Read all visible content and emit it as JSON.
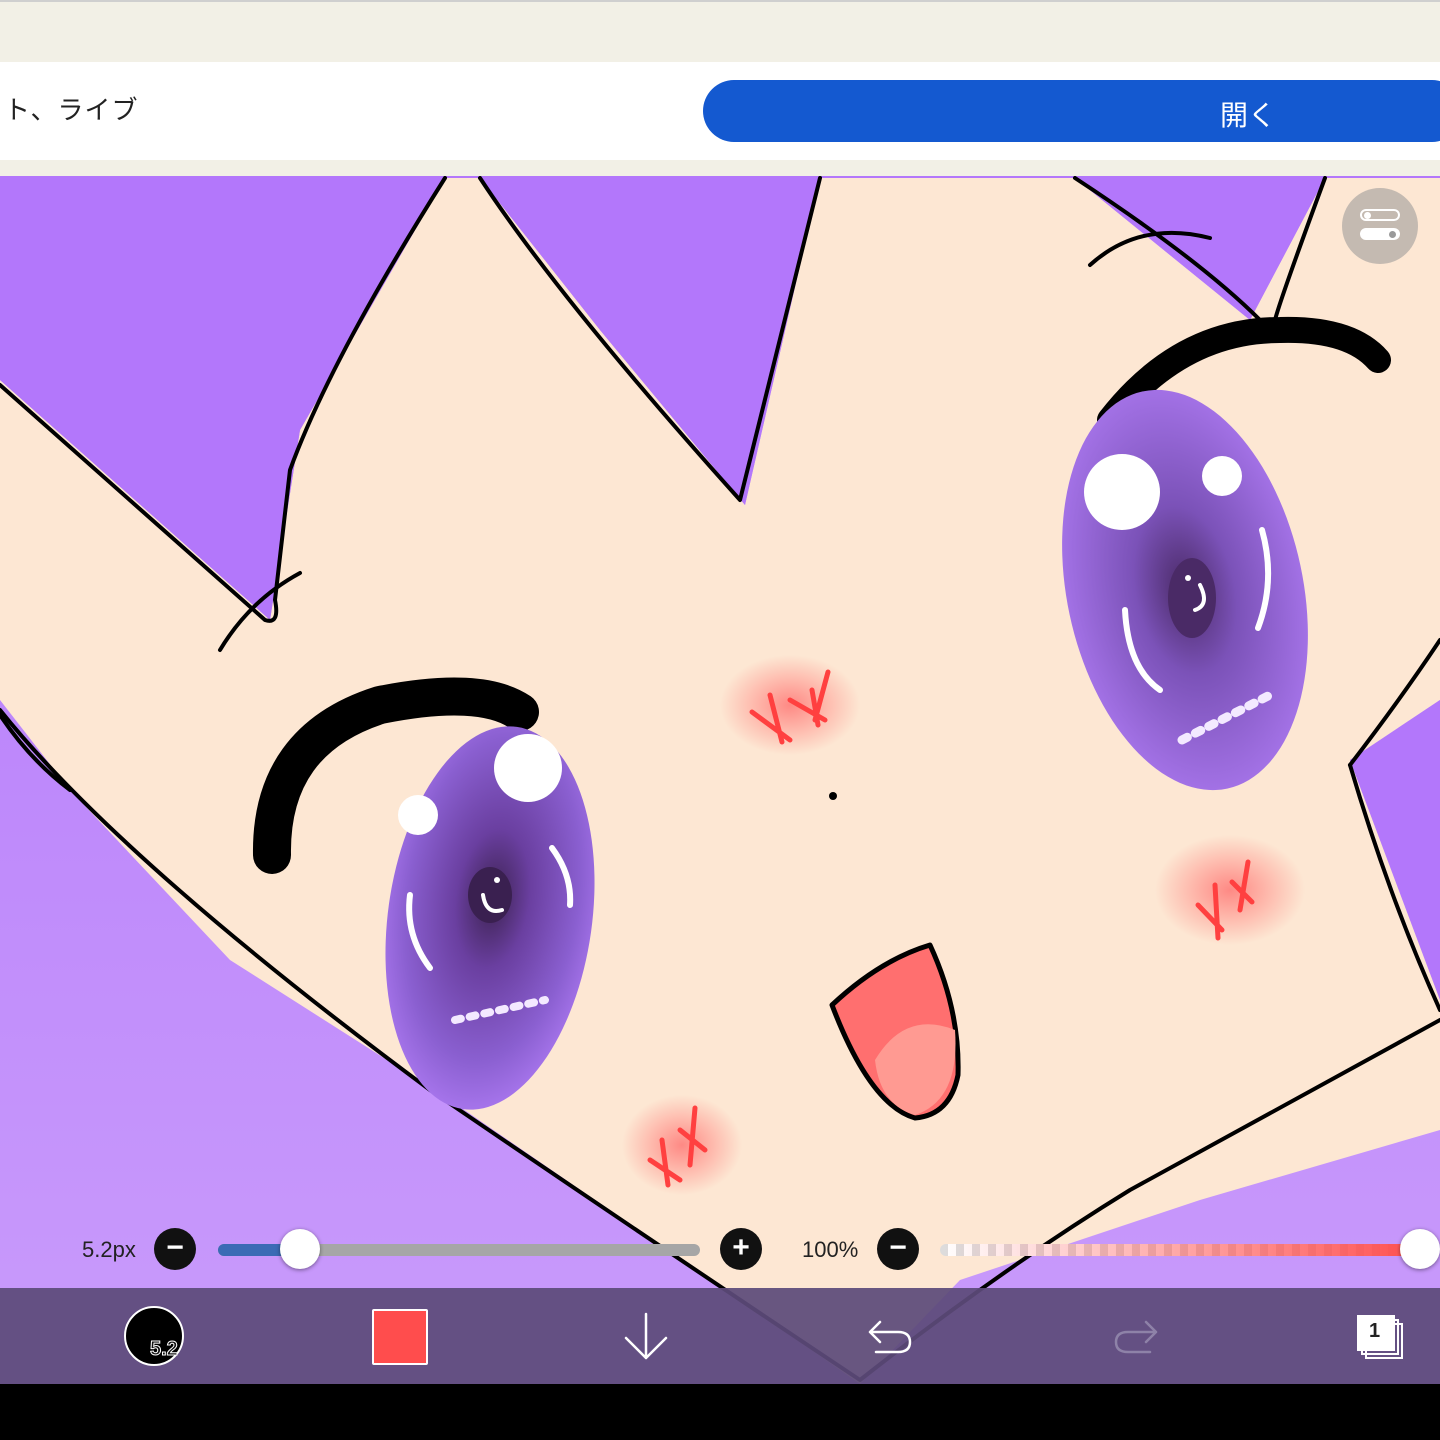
{
  "banner": {
    "text": "ト、ライブ",
    "open_button_label": "開く"
  },
  "brush": {
    "size_label": "5.2px",
    "size_short": "5.2",
    "size_fraction": 0.17
  },
  "opacity": {
    "label": "100%",
    "fraction": 1.0
  },
  "colors": {
    "current_color": "#ff4d4d",
    "open_button": "#1459d0",
    "toolbar": "#5c4a7a"
  },
  "layers": {
    "count": "1"
  },
  "icons": [
    "toggle-icon",
    "minus-icon",
    "plus-icon",
    "download-arrow-icon",
    "undo-icon",
    "redo-icon",
    "layers-icon"
  ]
}
